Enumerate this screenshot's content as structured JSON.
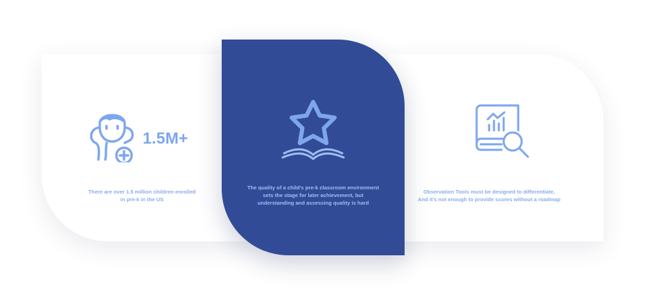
{
  "cards": [
    {
      "stat": "1.5M+",
      "icon": "child-icon",
      "text": "There are over 1.5 million children enrolled\nin pre-k in the US"
    },
    {
      "icon": "star-book-icon",
      "text": "The quality of a child's pre-k classroom environment\nsets the stage for later achievement, but\nunderstanding and assessing quality is hard"
    },
    {
      "icon": "report-search-icon",
      "text": "Observation Tools must be designed to differentiate,\nAnd it's not enough to provide scores without a roadmap"
    }
  ],
  "colors": {
    "accent": "#7ea6ef",
    "highlight_card": "#324b96",
    "text_light": "#8aaeea"
  }
}
